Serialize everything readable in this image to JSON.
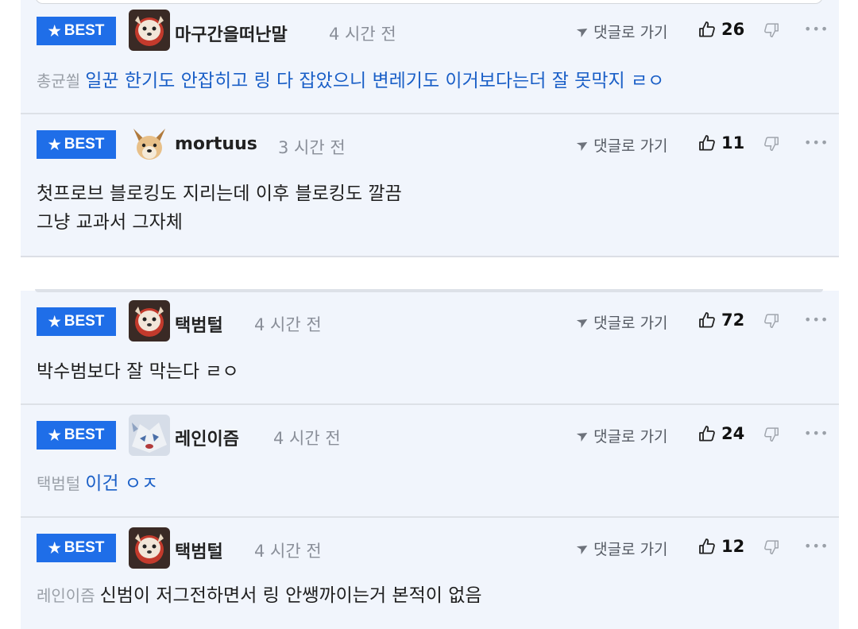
{
  "ui": {
    "best_label": "BEST",
    "reply_label": "댓글로 가기"
  },
  "comments": [
    {
      "user": "마구간을떠난말",
      "time": "4 시간 전",
      "likes": "26",
      "mention": "총균쐴",
      "text": "일꾼 한기도 안잡히고 링 다 잡았으니 변레기도 이거보다는더 잘 못막지 ㄹㅇ"
    },
    {
      "user": "mortuus",
      "time": "3 시간 전",
      "likes": "11",
      "line1": "첫프로브 블로킹도 지리는데 이후 블로킹도 깔끔",
      "line2": "그냥 교과서 그자체"
    },
    {
      "user": "택범털",
      "time": "4 시간 전",
      "likes": "72",
      "text": "박수범보다 잘 막는다 ㄹㅇ"
    },
    {
      "user": "레인이즘",
      "time": "4 시간 전",
      "likes": "24",
      "mention": "택범털",
      "text": "이건 ㅇㅈ"
    },
    {
      "user": "택범털",
      "time": "4 시간 전",
      "likes": "12",
      "mention": "레인이즘",
      "text": "신범이 저그전하면서 링 안쌩까이는거 본적이 없음"
    }
  ],
  "colors": {
    "best_badge": "#1f6ee8",
    "comment_bg": "#f1f5fc",
    "reply_text": "#1a5fc7",
    "mention": "#9aa0a8"
  }
}
